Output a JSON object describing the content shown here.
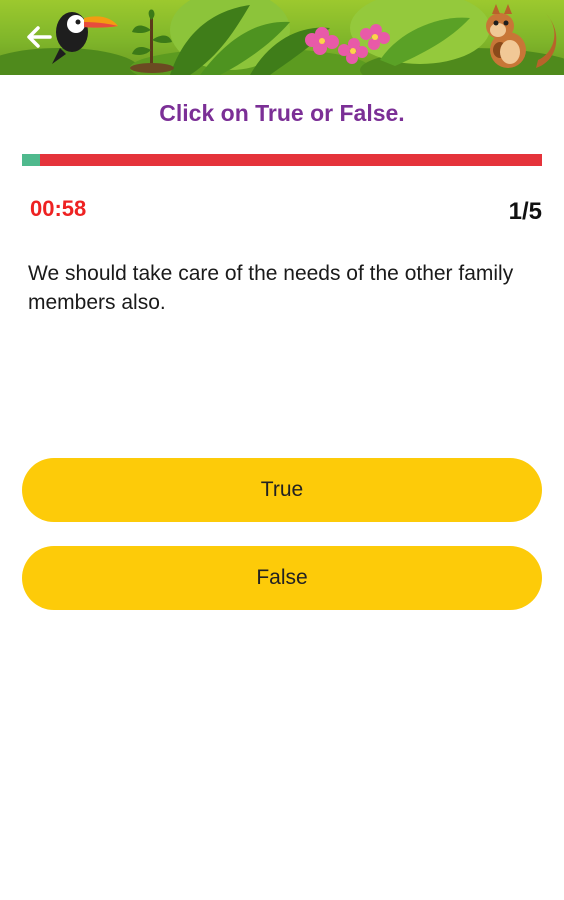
{
  "header": {
    "back_icon": "arrow-left-icon",
    "instruction": "Click on True or False."
  },
  "progress": {
    "fraction": 0.035,
    "track_color": "#e5333b",
    "fill_color": "#4fb98d"
  },
  "status": {
    "timer": "00:58",
    "counter": "1/5"
  },
  "question": {
    "text": "We should take care of the needs of the other family members also."
  },
  "options": [
    {
      "label": "True"
    },
    {
      "label": "False"
    }
  ],
  "colors": {
    "instruction": "#7b2f96",
    "timer": "#ee2222",
    "option_button": "#fdcb09"
  }
}
